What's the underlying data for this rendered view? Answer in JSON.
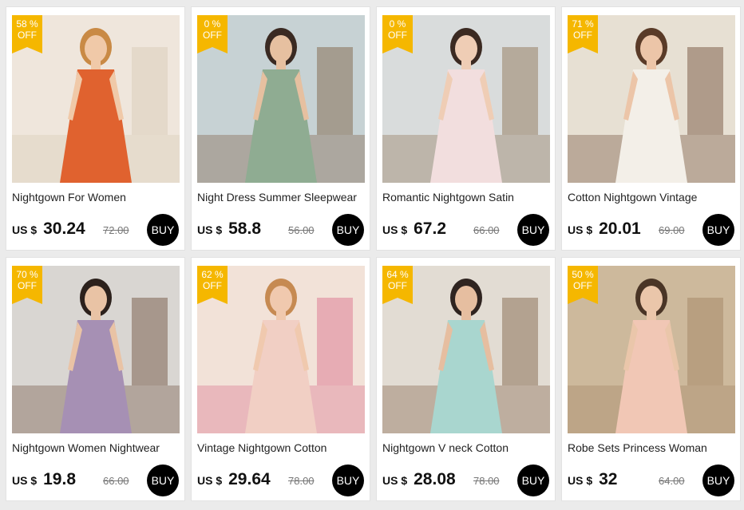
{
  "currency": "US $",
  "buy_label": "BUY",
  "off_label": "OFF",
  "products": [
    {
      "title": "Nightgown For Women",
      "price": "30.24",
      "old_price": "72.00",
      "discount": "58 %",
      "bg": "#efe6dc",
      "dress": "#e0622f",
      "skin": "#f0c9a8",
      "hair": "#c98a45",
      "accent": "#d7c9b3"
    },
    {
      "title": "Night Dress Summer Sleepwear",
      "price": "58.8",
      "old_price": "56.00",
      "discount": "0 %",
      "bg": "#c7d2d4",
      "dress": "#8fac92",
      "skin": "#e6c0a0",
      "hair": "#3a2a22",
      "accent": "#7a5a3b"
    },
    {
      "title": "Romantic Nightgown Satin",
      "price": "67.2",
      "old_price": "66.00",
      "discount": "0 %",
      "bg": "#d9dcdc",
      "dress": "#f2dede",
      "skin": "#efcdb5",
      "hair": "#3b2a22",
      "accent": "#8a6d4c"
    },
    {
      "title": "Cotton Nightgown Vintage",
      "price": "20.01",
      "old_price": "69.00",
      "discount": "71 %",
      "bg": "#e7e0d3",
      "dress": "#f3efe8",
      "skin": "#ecc5a8",
      "hair": "#5a3b28",
      "accent": "#6a4630"
    },
    {
      "title": "Nightgown Women Nightwear",
      "price": "19.8",
      "old_price": "66.00",
      "discount": "70 %",
      "bg": "#d9d6d2",
      "dress": "#a690b4",
      "skin": "#e9c3a5",
      "hair": "#2c211c",
      "accent": "#6b4b38"
    },
    {
      "title": "Vintage Nightgown Cotton",
      "price": "29.64",
      "old_price": "78.00",
      "discount": "62 %",
      "bg": "#f2e2d8",
      "dress": "#f1cfc4",
      "skin": "#f0c9ae",
      "hair": "#c68a52",
      "accent": "#d96b8a"
    },
    {
      "title": "Nightgown V neck Cotton",
      "price": "28.08",
      "old_price": "78.00",
      "discount": "64 %",
      "bg": "#e2dcd3",
      "dress": "#a9d6cf",
      "skin": "#e6bea0",
      "hair": "#2f2420",
      "accent": "#7a5a3e"
    },
    {
      "title": "Robe Sets Princess Woman",
      "price": "32",
      "old_price": "64.00",
      "discount": "50 %",
      "bg": "#cdb99c",
      "dress": "#f1c7b5",
      "skin": "#eac6aa",
      "hair": "#4a3526",
      "accent": "#a08060"
    }
  ]
}
